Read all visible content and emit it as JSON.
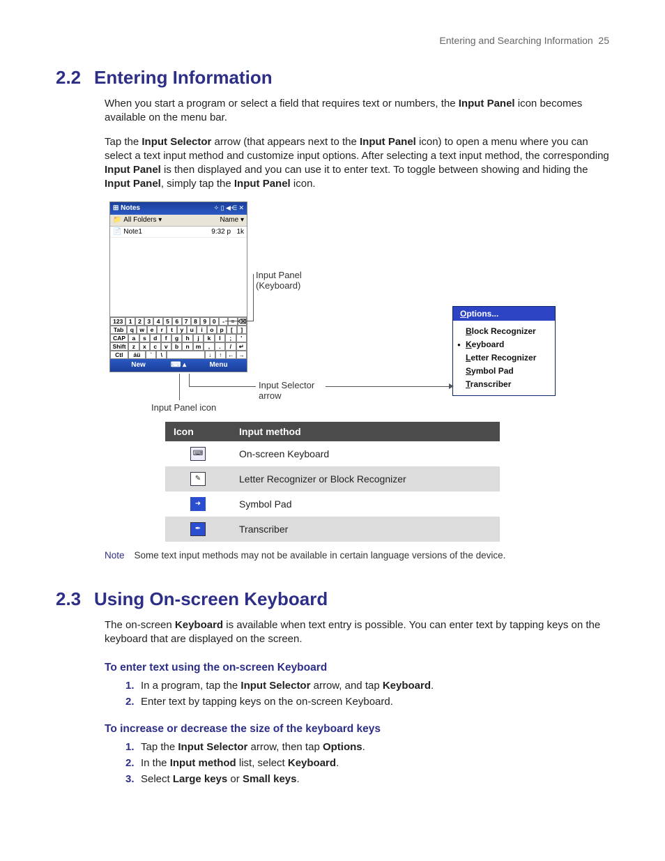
{
  "header": {
    "chapter": "Entering and Searching Information",
    "page": "25"
  },
  "s22": {
    "num": "2.2",
    "title": "Entering Information",
    "p1a": "When you start a program or select a field that requires text or numbers, the ",
    "p1b": "Input Panel",
    "p1c": " icon becomes available on the menu bar.",
    "p2a": "Tap the ",
    "p2b": "Input Selector",
    "p2c": " arrow (that appears next to the ",
    "p2d": "Input Panel",
    "p2e": " icon) to open a menu where you can select a text input method and customize input options. After selecting a text input method, the corresponding ",
    "p2f": "Input Panel",
    "p2g": " is then displayed and you can use it to enter text. To toggle between showing and hiding the ",
    "p2h": "Input Panel",
    "p2i": ", simply tap the ",
    "p2j": "Input Panel",
    "p2k": " icon."
  },
  "device": {
    "title": "Notes",
    "status": "✧ ▯ ◀⋲ ✕",
    "folders": "All Folders ▾",
    "sort": "Name ▾",
    "row_name": "Note1",
    "row_time": "9:32 p",
    "row_size": "1k",
    "bar_left": "New",
    "bar_mid": "⌨ ▴",
    "bar_right": "Menu",
    "kbd_r1": [
      "123",
      "1",
      "2",
      "3",
      "4",
      "5",
      "6",
      "7",
      "8",
      "9",
      "0",
      "-",
      "=",
      "⌫"
    ],
    "kbd_r2": [
      "Tab",
      "q",
      "w",
      "e",
      "r",
      "t",
      "y",
      "u",
      "i",
      "o",
      "p",
      "[",
      "]"
    ],
    "kbd_r3": [
      "CAP",
      "a",
      "s",
      "d",
      "f",
      "g",
      "h",
      "j",
      "k",
      "l",
      ";",
      "'"
    ],
    "kbd_r4": [
      "Shift",
      "z",
      "x",
      "c",
      "v",
      "b",
      "n",
      "m",
      ",",
      ".",
      "/",
      "↵"
    ],
    "kbd_r5": [
      "Ctl",
      "áü",
      "`",
      "\\",
      " ",
      "↓",
      "↑",
      "←",
      "→"
    ]
  },
  "menu": {
    "options": "Options...",
    "items": [
      "Block Recognizer",
      "Keyboard",
      "Letter Recognizer",
      "Symbol Pad",
      "Transcriber"
    ],
    "selected": 1
  },
  "callouts": {
    "panel": "Input Panel\n(Keyboard)",
    "selector": "Input Selector\narrow",
    "icon": "Input Panel icon"
  },
  "table": {
    "h1": "Icon",
    "h2": "Input method",
    "rows": [
      {
        "icon": "kbd",
        "label": "On-screen Keyboard"
      },
      {
        "icon": "pen",
        "label": "Letter Recognizer or Block Recognizer"
      },
      {
        "icon": "sym",
        "label": "Symbol Pad"
      },
      {
        "icon": "trans",
        "label": "Transcriber"
      }
    ]
  },
  "note": {
    "label": "Note",
    "text": "Some text input methods may not be available in certain language versions of the device."
  },
  "s23": {
    "num": "2.3",
    "title": "Using On-screen Keyboard",
    "p1a": "The on-screen ",
    "p1b": "Keyboard",
    "p1c": " is available when text entry is possible. You can enter text by tapping keys on the keyboard that are displayed on the screen.",
    "h1": "To enter text using the on-screen Keyboard",
    "list1": [
      {
        "a": "In a program, tap the ",
        "b": "Input Selector",
        "c": " arrow, and tap ",
        "d": "Keyboard",
        "e": "."
      },
      {
        "a": "Enter text by tapping keys on the on-screen Keyboard."
      }
    ],
    "h2": "To increase or decrease the size of the keyboard keys",
    "list2": [
      {
        "a": "Tap the ",
        "b": "Input Selector",
        "c": " arrow, then tap ",
        "d": "Options",
        "e": "."
      },
      {
        "a": "In the ",
        "b": "Input method",
        "c": " list, select ",
        "d": "Keyboard",
        "e": "."
      },
      {
        "a": "Select ",
        "b": "Large keys",
        "c": " or ",
        "d": "Small keys",
        "e": "."
      }
    ]
  }
}
